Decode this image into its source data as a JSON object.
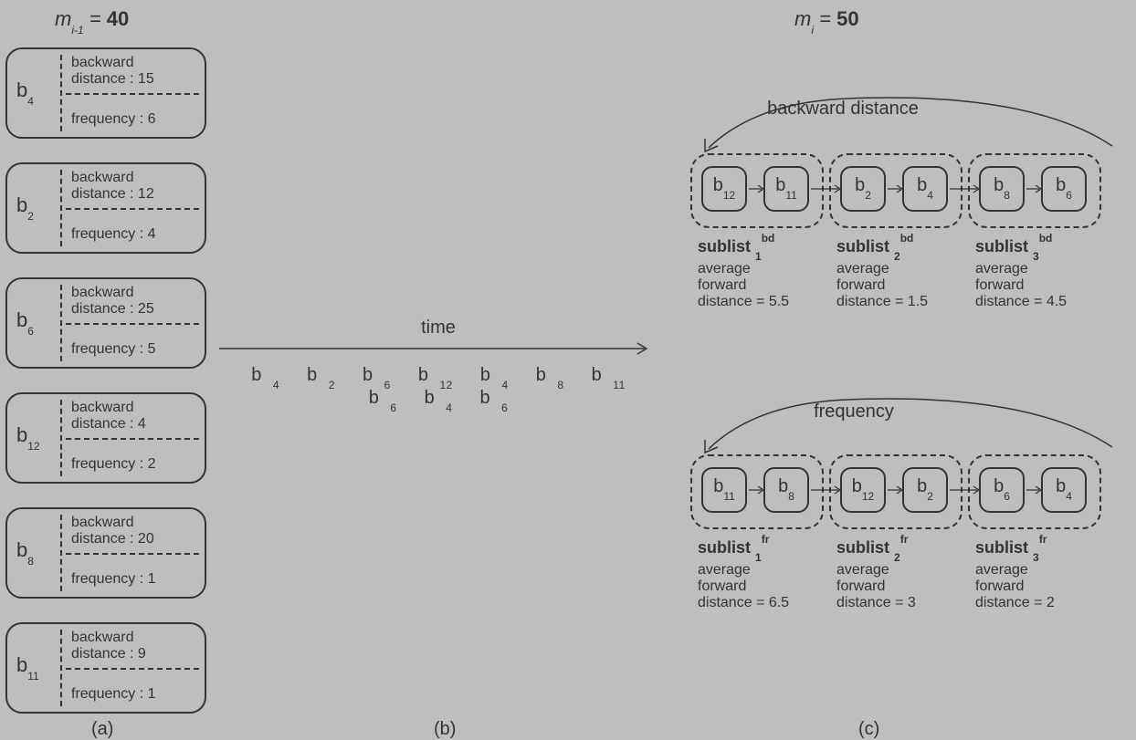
{
  "header_left": {
    "m": "m",
    "idx": "i-1",
    "eq": " = ",
    "val": "40"
  },
  "header_right": {
    "m": "m",
    "idx": "i",
    "eq": " = ",
    "val": "50"
  },
  "boxes": [
    {
      "id_b": "b",
      "id_n": "4",
      "bd_line1": "backward",
      "bd_line2": "distance :  15",
      "fr": "frequency : 6"
    },
    {
      "id_b": "b",
      "id_n": "2",
      "bd_line1": "backward",
      "bd_line2": "distance :  12",
      "fr": "frequency : 4"
    },
    {
      "id_b": "b",
      "id_n": "6",
      "bd_line1": "backward",
      "bd_line2": "distance :  25",
      "fr": "frequency : 5"
    },
    {
      "id_b": "b",
      "id_n": "12",
      "bd_line1": "backward",
      "bd_line2": "distance :    4",
      "fr": "frequency : 2"
    },
    {
      "id_b": "b",
      "id_n": "8",
      "bd_line1": "backward",
      "bd_line2": "distance :  20",
      "fr": "frequency : 1"
    },
    {
      "id_b": "b",
      "id_n": "11",
      "bd_line1": "backward",
      "bd_line2": "distance :    9",
      "fr": "frequency : 1"
    }
  ],
  "time_label": "time",
  "sequence": [
    "b4",
    "b2",
    "b6",
    "b12",
    "b4",
    "b8",
    "b11",
    "b6",
    "b4",
    "b6"
  ],
  "seq_b": "b",
  "seq_n": [
    "4",
    "2",
    "6",
    "12",
    "4",
    "8",
    "11",
    "6",
    "4",
    "6"
  ],
  "panels": {
    "a": "(a)",
    "b": "(b)",
    "c": "(c)"
  },
  "group_bd": {
    "title": "backward distance",
    "nodes": [
      {
        "b": "b",
        "n": "12"
      },
      {
        "b": "b",
        "n": "11"
      },
      {
        "b": "b",
        "n": "2"
      },
      {
        "b": "b",
        "n": "4"
      },
      {
        "b": "b",
        "n": "8"
      },
      {
        "b": "b",
        "n": "6"
      }
    ],
    "sublabels": [
      {
        "word": "sublist",
        "idx": "1",
        "sup": "bd",
        "avg1": "average",
        "avg2": "forward",
        "avg3": "distance = 5.5"
      },
      {
        "word": "sublist",
        "idx": "2",
        "sup": "bd",
        "avg1": "average",
        "avg2": "forward",
        "avg3": "distance = 1.5"
      },
      {
        "word": "sublist",
        "idx": "3",
        "sup": "bd",
        "avg1": "average",
        "avg2": "forward",
        "avg3": "distance = 4.5"
      }
    ]
  },
  "group_fr": {
    "title": "frequency",
    "nodes": [
      {
        "b": "b",
        "n": "11"
      },
      {
        "b": "b",
        "n": "8"
      },
      {
        "b": "b",
        "n": "12"
      },
      {
        "b": "b",
        "n": "2"
      },
      {
        "b": "b",
        "n": "6"
      },
      {
        "b": "b",
        "n": "4"
      }
    ],
    "sublabels": [
      {
        "word": "sublist",
        "idx": "1",
        "sup": "fr",
        "avg1": "average",
        "avg2": "forward",
        "avg3": "distance = 6.5"
      },
      {
        "word": "sublist",
        "idx": "2",
        "sup": "fr",
        "avg1": "average",
        "avg2": "forward",
        "avg3": "distance = 3"
      },
      {
        "word": "sublist",
        "idx": "3",
        "sup": "fr",
        "avg1": "average",
        "avg2": "forward",
        "avg3": "distance = 2"
      }
    ]
  }
}
